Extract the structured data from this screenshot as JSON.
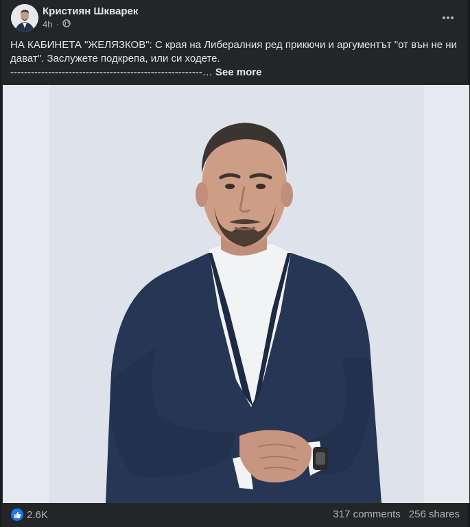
{
  "post": {
    "author": "Кристиян Шкварек",
    "timestamp": "4h",
    "separator": "·",
    "privacy_icon": "globe-icon",
    "menu_icon": "more-horizontal-icon",
    "text_line1": "НА КАБИНЕТА \"ЖЕЛЯЗКОВ\": С края на Либералния ред прикючи и аргументът \"от вън не ни дават\". Заслужете подкрепа, или си ходете.",
    "dashes": "--------------------------------------------------------",
    "ellipsis": "…",
    "see_more": "See more"
  },
  "footer": {
    "reaction_icon": "like-icon",
    "reaction_count": "2.6K",
    "comments": "317 comments",
    "shares": "256 shares"
  },
  "colors": {
    "background": "#18191a",
    "card": "#242526",
    "text": "#e4e6eb",
    "secondary_text": "#b0b3b8",
    "like_blue": "#1877f2"
  }
}
